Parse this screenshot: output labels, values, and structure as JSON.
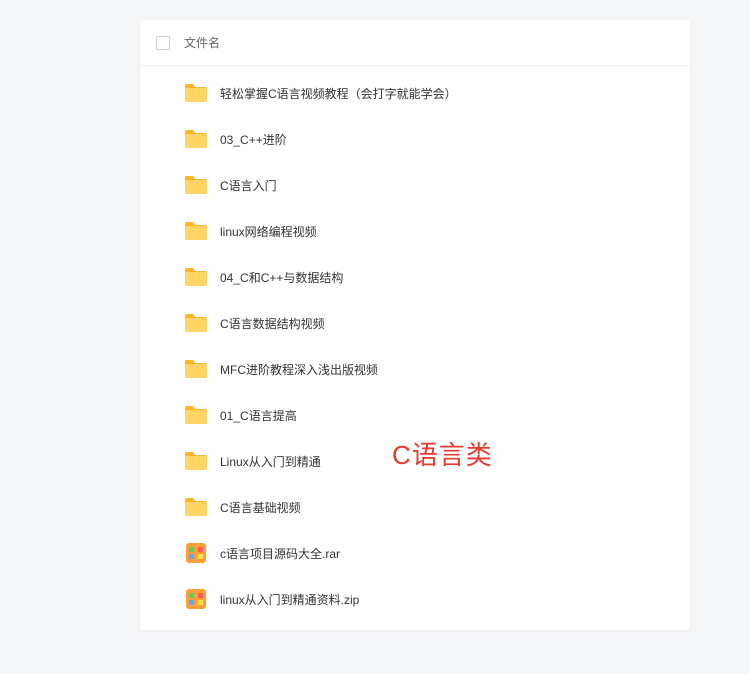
{
  "header": {
    "column_label": "文件名"
  },
  "overlay": {
    "text": "C语言类"
  },
  "items": [
    {
      "type": "folder",
      "name": "轻松掌握C语言视频教程（会打字就能学会）"
    },
    {
      "type": "folder",
      "name": "03_C++进阶"
    },
    {
      "type": "folder",
      "name": "C语言入门"
    },
    {
      "type": "folder",
      "name": "linux网络编程视频"
    },
    {
      "type": "folder",
      "name": "04_C和C++与数据结构"
    },
    {
      "type": "folder",
      "name": "C语言数据结构视频"
    },
    {
      "type": "folder",
      "name": "MFC进阶教程深入浅出版视频"
    },
    {
      "type": "folder",
      "name": "01_C语言提高"
    },
    {
      "type": "folder",
      "name": "Linux从入门到精通"
    },
    {
      "type": "folder",
      "name": "C语言基础视频"
    },
    {
      "type": "archive",
      "name": "c语言项目源码大全.rar"
    },
    {
      "type": "archive",
      "name": "linux从入门到精通资料.zip"
    }
  ]
}
